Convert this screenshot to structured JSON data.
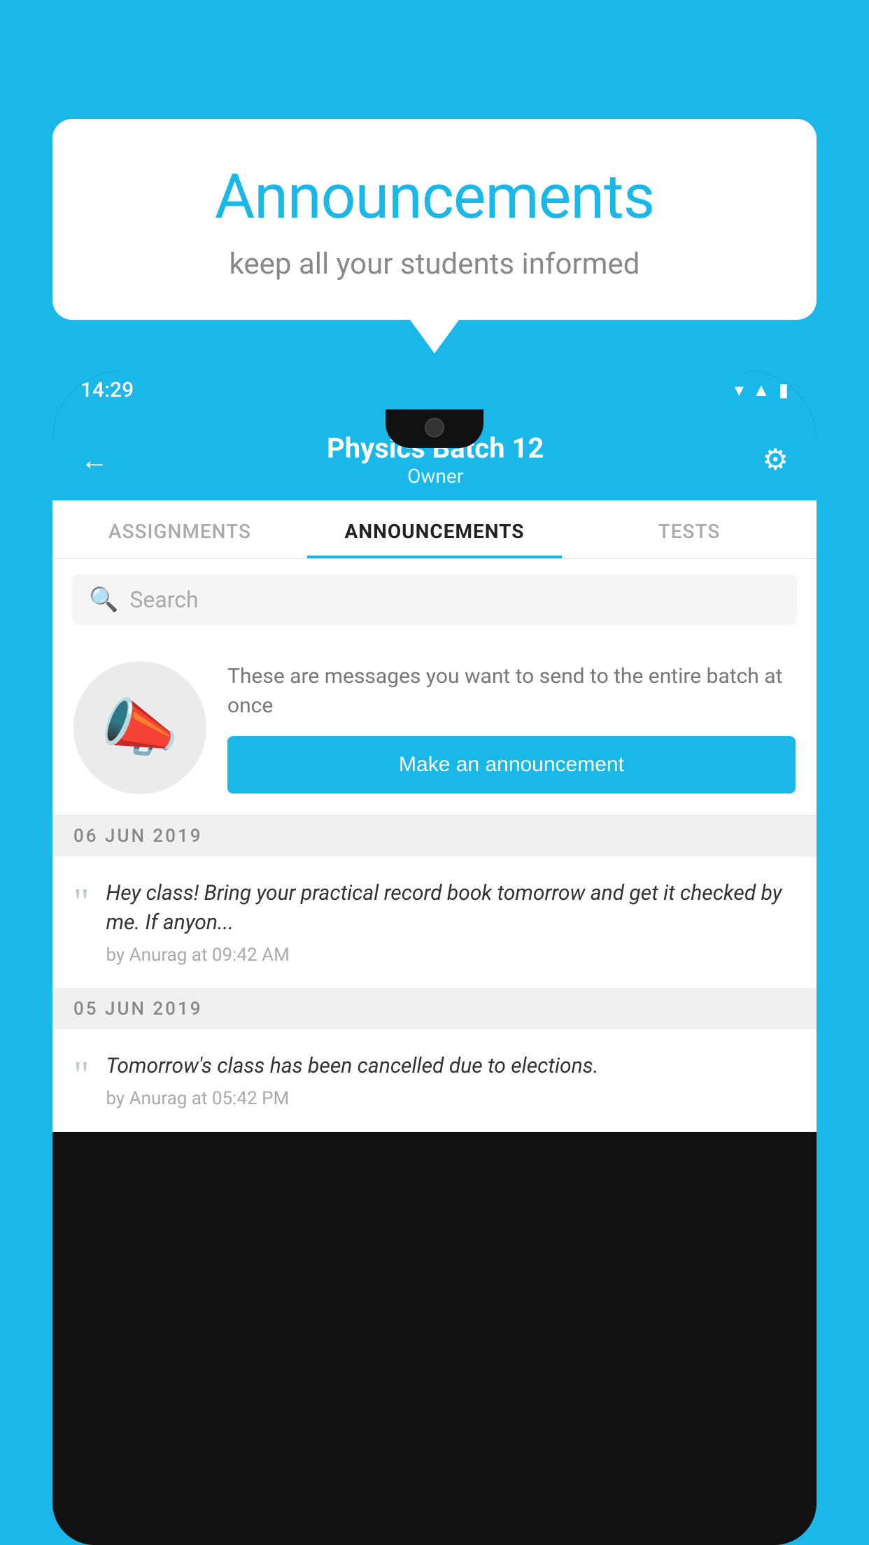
{
  "background_color": "#1ab8e8",
  "speech_bubble": {
    "title": "Announcements",
    "subtitle": "keep all your students informed"
  },
  "status_bar": {
    "time": "14:29",
    "icons": [
      "wifi",
      "signal",
      "battery"
    ]
  },
  "header": {
    "title": "Physics Batch 12",
    "subtitle": "Owner",
    "back_label": "←",
    "gear_label": "⚙"
  },
  "tabs": [
    {
      "label": "ASSIGNMENTS",
      "active": false
    },
    {
      "label": "ANNOUNCEMENTS",
      "active": true
    },
    {
      "label": "TESTS",
      "active": false
    },
    {
      "label": "...",
      "active": false
    }
  ],
  "search": {
    "placeholder": "Search"
  },
  "announcement_prompt": {
    "description": "These are messages you want to send to the entire batch at once",
    "button_label": "Make an announcement"
  },
  "announcements": [
    {
      "date": "06  JUN  2019",
      "message": "Hey class! Bring your practical record book tomorrow and get it checked by me. If anyon...",
      "meta": "by Anurag at 09:42 AM"
    },
    {
      "date": "05  JUN  2019",
      "message": "Tomorrow's class has been cancelled due to elections.",
      "meta": "by Anurag at 05:42 PM"
    }
  ]
}
